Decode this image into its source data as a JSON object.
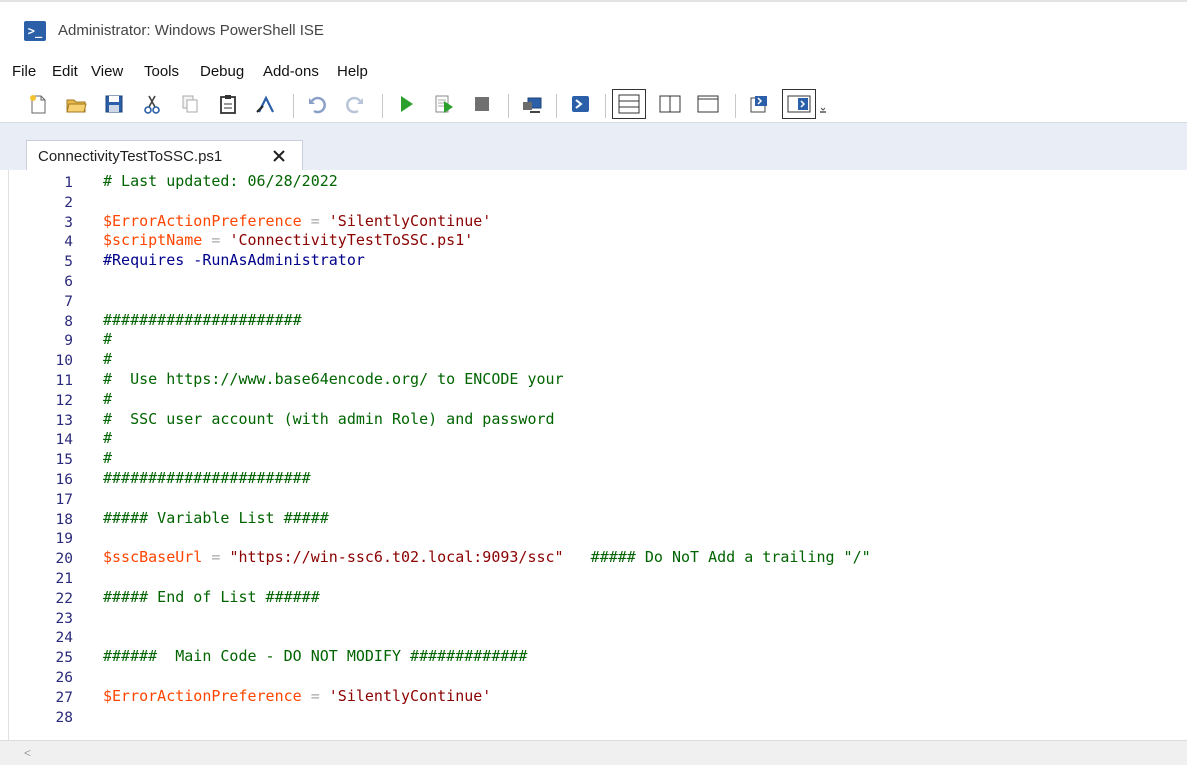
{
  "window": {
    "title": "Administrator: Windows PowerShell ISE",
    "icon": "powershell-icon"
  },
  "menu": [
    "File",
    "Edit",
    "View",
    "Tools",
    "Debug",
    "Add-ons",
    "Help"
  ],
  "toolbar": {
    "buttons": [
      "new-icon",
      "open-icon",
      "save-icon",
      "cut-icon",
      "copy-icon",
      "paste-icon",
      "show-command-icon",
      "undo-icon",
      "redo-icon",
      "run-icon",
      "run-selection-icon",
      "stop-icon",
      "remote-icon",
      "powershell-icon",
      "layout-top-icon",
      "layout-right-icon",
      "layout-max-icon",
      "addon-icon",
      "command-pane-icon",
      "overflow-icon"
    ]
  },
  "tab": {
    "label": "ConnectivityTestToSSC.ps1",
    "close": "✕"
  },
  "editor": {
    "line_numbers": [
      "1",
      "2",
      "3",
      "4",
      "5",
      "6",
      "7",
      "8",
      "9",
      "10",
      "11",
      "12",
      "13",
      "14",
      "15",
      "16",
      "17",
      "18",
      "19",
      "20",
      "21",
      "22",
      "23",
      "24",
      "25",
      "26",
      "27",
      "28"
    ],
    "lines": [
      [
        {
          "t": "# Last updated: 06/28/2022",
          "k": "comment"
        }
      ],
      [],
      [
        {
          "t": "$ErrorActionPreference",
          "k": "var"
        },
        {
          "t": " = ",
          "k": "op"
        },
        {
          "t": "'SilentlyContinue'",
          "k": "str"
        }
      ],
      [
        {
          "t": "$scriptName",
          "k": "var"
        },
        {
          "t": " = ",
          "k": "op"
        },
        {
          "t": "'ConnectivityTestToSSC.ps1'",
          "k": "str"
        }
      ],
      [
        {
          "t": "#Requires -RunAsAdministrator",
          "k": "kw"
        }
      ],
      [],
      [],
      [
        {
          "t": "######################",
          "k": "comment"
        }
      ],
      [
        {
          "t": "#",
          "k": "comment"
        }
      ],
      [
        {
          "t": "#",
          "k": "comment"
        }
      ],
      [
        {
          "t": "#  Use https://www.base64encode.org/ to ENCODE your",
          "k": "comment"
        }
      ],
      [
        {
          "t": "#",
          "k": "comment"
        }
      ],
      [
        {
          "t": "#  SSC user account (with admin Role) and password",
          "k": "comment"
        }
      ],
      [
        {
          "t": "#",
          "k": "comment"
        }
      ],
      [
        {
          "t": "#",
          "k": "comment"
        }
      ],
      [
        {
          "t": "#######################",
          "k": "comment"
        }
      ],
      [],
      [
        {
          "t": "##### Variable List #####",
          "k": "comment"
        }
      ],
      [],
      [
        {
          "t": "$sscBaseUrl",
          "k": "var"
        },
        {
          "t": " = ",
          "k": "op"
        },
        {
          "t": "\"https://win-ssc6.t02.local:9093/ssc\"",
          "k": "str"
        },
        {
          "t": "   ##### Do NoT Add a trailing \"/\"",
          "k": "comment"
        }
      ],
      [],
      [
        {
          "t": "##### End of List ######",
          "k": "comment"
        }
      ],
      [],
      [],
      [
        {
          "t": "######  Main Code - DO NOT MODIFY #############",
          "k": "comment"
        }
      ],
      [],
      [
        {
          "t": "$ErrorActionPreference",
          "k": "var"
        },
        {
          "t": " = ",
          "k": "op"
        },
        {
          "t": "'SilentlyContinue'",
          "k": "str"
        }
      ],
      []
    ]
  },
  "colors": {
    "comment": "#006400",
    "variable": "#ff4500",
    "string": "#8b0000",
    "operator": "#a9a9a9",
    "keyword": "#00008b",
    "line_number": "#2a2a7a"
  }
}
